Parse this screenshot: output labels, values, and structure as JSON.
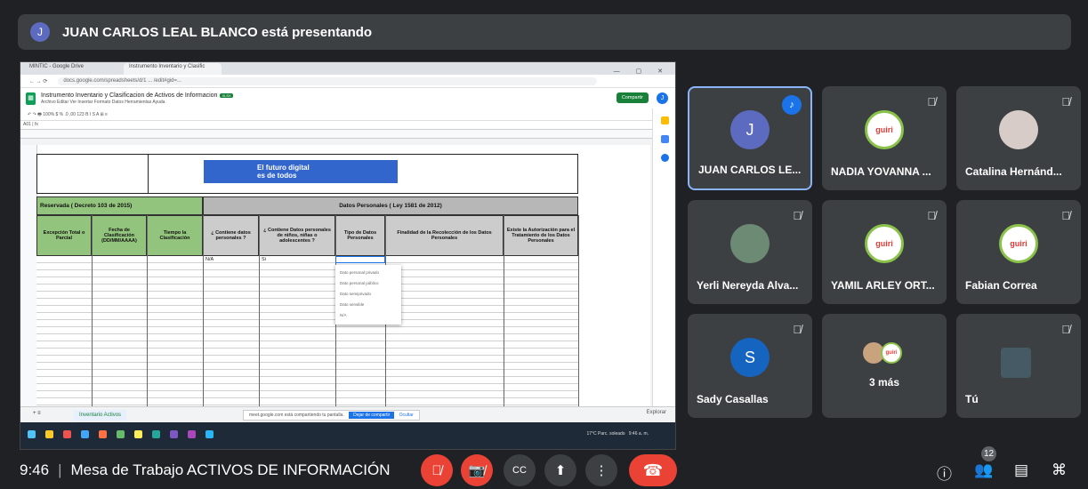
{
  "presenter_banner": {
    "initial": "J",
    "text": "JUAN CARLOS LEAL BLANCO está presentando"
  },
  "shared_screen": {
    "browser_tabs": [
      "MINTIC - Google Drive",
      "Instrumento Inventario y Clasific"
    ],
    "url": "docs.google.com/spreadsheets/d/1 ... /edit#gid=...",
    "doc_title": "Instrumento Inventario y Clasificacion de Activos de Informacion",
    "doc_badge": "XLSX",
    "menus": "Archivo  Editar  Ver  Insertar  Formato  Datos  Herramientas  Ayuda",
    "share_button": "Compartir",
    "account_initial": "J",
    "cell_ref": "A01",
    "banner_line1": "El futuro digital",
    "banner_line2": "es de todos",
    "group_left": "Reservada ( Decreto 103 de 2015)",
    "group_right": "Datos Personales ( Ley 1581 de 2012)",
    "columns": [
      "Excepción Total o Parcial",
      "Fecha de Clasificación (DD/MM/AAAA)",
      "Tiempo la Clasificación",
      "¿ Contiene datos personales ?",
      "¿ Contiene Datos personales de niños, niñas o adolescentes ?",
      "Tipo de Datos Personales",
      "Finalidad de la Recolección de los Datos Personales",
      "Existe la Autorización para el Tratamiento de los Datos Personales"
    ],
    "cell_values": {
      "contiene": "N/A",
      "ninos": "Si"
    },
    "dropdown_options": [
      "Dato personal privado",
      "Dato personal público",
      "Dato semiprivado",
      "Dato sensible",
      "N/A"
    ],
    "sheet_tab": "Inventario Activos",
    "share_notice": "meet.google.com está compartiendo tu pantalla.",
    "share_notice_stop": "Dejar de compartir",
    "share_notice_hide": "Ocultar",
    "explore_label": "Explorar",
    "tray_text": "17°C Parc. soleado",
    "clock_time": "9:46 a. m."
  },
  "participants": [
    {
      "name": "JUAN CARLOS LE...",
      "avatar": "J",
      "avatar_color": "#5c6bc0",
      "speaking": true
    },
    {
      "name": "NADIA YOVANNA ...",
      "avatar_logo": "guiri",
      "muted": true
    },
    {
      "name": "Catalina Hernánd...",
      "muted": true
    },
    {
      "name": "Yerli Nereyda Alva...",
      "muted": true
    },
    {
      "name": "YAMIL ARLEY ORT...",
      "avatar_logo": "guiri",
      "muted": true
    },
    {
      "name": "Fabian Correa",
      "avatar_logo": "guiri",
      "muted": true
    },
    {
      "name": "Sady Casallas",
      "avatar": "S",
      "avatar_color": "#1565c0",
      "muted": true
    },
    {
      "name": "3 más"
    },
    {
      "name": "Tú",
      "muted": true
    }
  ],
  "bottom_bar": {
    "time": "9:46",
    "meeting_title": "Mesa de Trabajo ACTIVOS DE INFORMACIÓN",
    "participant_count": "12"
  },
  "colors": {
    "accent_red": "#ea4335",
    "tile_bg": "#3c4043",
    "active_border": "#8ab4f8"
  }
}
